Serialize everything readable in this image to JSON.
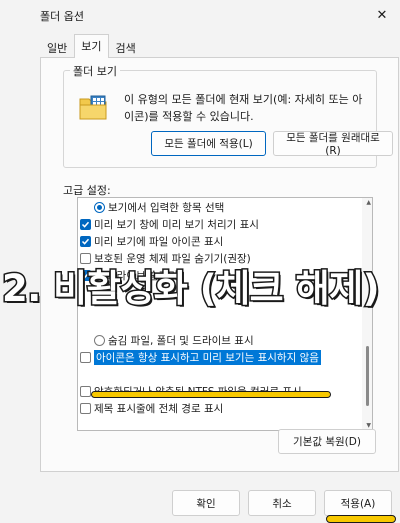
{
  "window": {
    "title": "폴더 옵션",
    "close_glyph": "✕"
  },
  "tabs": [
    {
      "label": "일반"
    },
    {
      "label": "보기"
    },
    {
      "label": "검색"
    }
  ],
  "folder_view": {
    "legend": "폴더 보기",
    "desc_line1": "이 유형의 모든 폴더에 현재 보기(예: 자세히 또는 아",
    "desc_line2": "이콘)를 적용할 수 있습니다.",
    "apply_all_button": "모든 폴더에 적용(L)",
    "reset_button": "모든 폴더를 원래대로(R)"
  },
  "advanced": {
    "label": "고급 설정:",
    "items": [
      {
        "type": "radio",
        "checked": true,
        "text": "보기에서 입력한 항목 선택"
      },
      {
        "type": "check",
        "checked": true,
        "text": "미리 보기 창에 미리 보기 처리기 표시"
      },
      {
        "type": "check",
        "checked": true,
        "text": "미리 보기에 파일 아이콘 표시"
      },
      {
        "type": "check",
        "checked": false,
        "text": "보호된 운영 체제 파일 숨기기(권장)"
      },
      {
        "type": "check",
        "checked": true,
        "text": "빈 드라이브 숨기기"
      },
      {
        "type": "radio",
        "checked": false,
        "text": "숨김 파일, 폴더 및 드라이브 표시"
      },
      {
        "type": "check",
        "checked": false,
        "text": "아이콘은 항상 표시하고 미리 보기는 표시하지 않음"
      },
      {
        "type": "check",
        "checked": false,
        "text": "암호화되거나 압축된 NTFS 파일을 컬러로 표시"
      },
      {
        "type": "check",
        "checked": false,
        "text": "제목 표시줄에 전체 경로 표시"
      }
    ],
    "restore_button": "기본값 복원(D)"
  },
  "annotation": {
    "text": "2. 비활성화 (체크 해제)"
  },
  "footer": {
    "ok": "확인",
    "cancel": "취소",
    "apply": "적용(A)"
  },
  "colors": {
    "accent": "#0067c0",
    "highlight": "#0078d7",
    "marker": "#f7c800"
  }
}
